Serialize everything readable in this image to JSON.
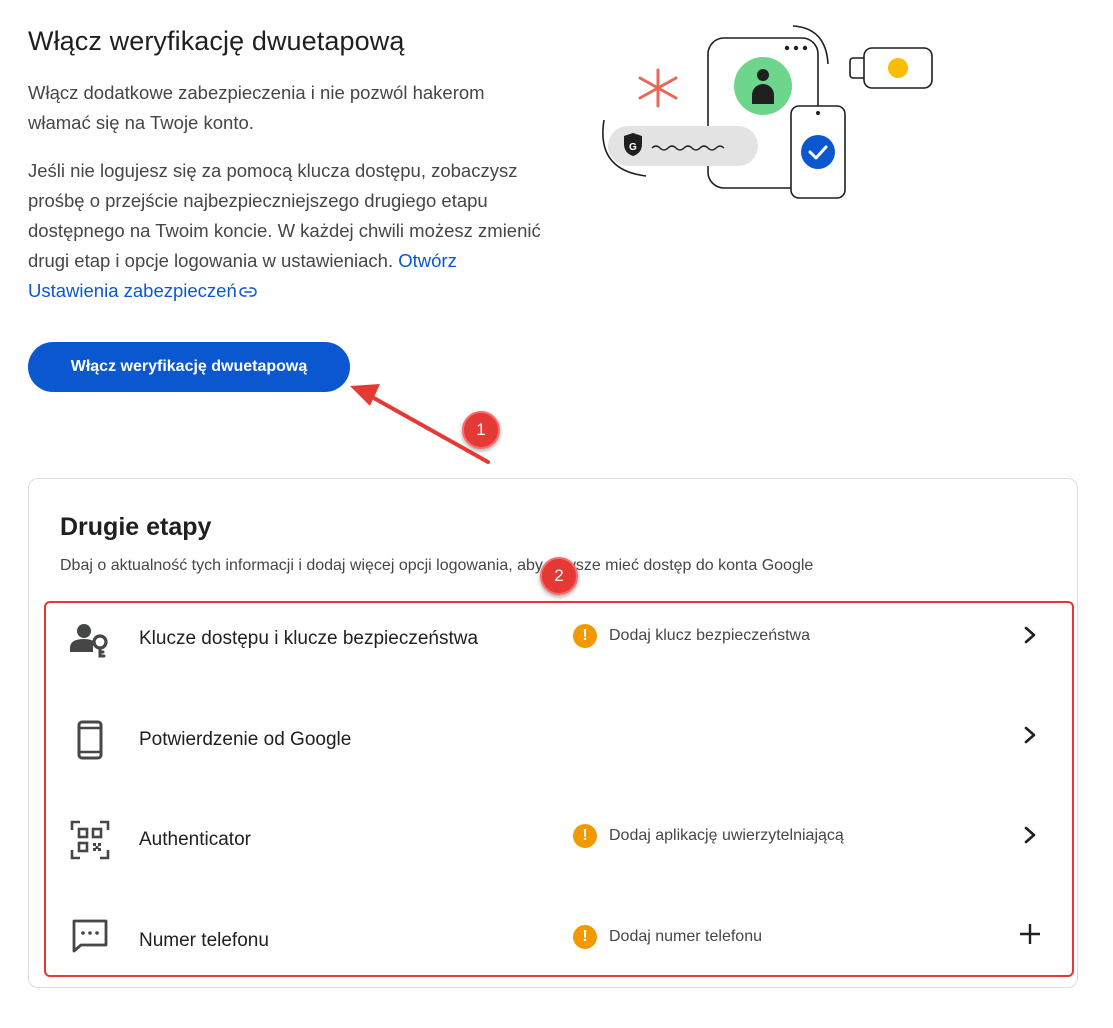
{
  "intro": {
    "title": "Włącz weryfikację dwuetapową",
    "paragraph1": "Włącz dodatkowe zabezpieczenia i nie pozwól hakerom włamać się na Twoje konto.",
    "paragraph2": "Jeśli nie logujesz się za pomocą klucza dostępu, zobaczysz prośbę o przejście najbezpieczniejszego drugiego etapu dostępnego na Twoim koncie. W każdej chwili możesz zmienić drugi etap i opcje logowania w ustawieniach.",
    "settings_link": "Otwórz Ustawienia zabezpieczeń",
    "enable_button": "Włącz weryfikację dwuetapową"
  },
  "annotations": {
    "marker1": "1",
    "marker2": "2",
    "color": "#e53935"
  },
  "second_steps": {
    "title": "Drugie etapy",
    "description": "Dbaj o aktualność tych informacji i dodaj więcej opcji logowania, aby zawsze mieć dostęp do konta Google",
    "items": [
      {
        "label": "Klucze dostępu i klucze bezpieczeństwa",
        "status": "Dodaj klucz bezpieczeństwa",
        "icon": "passkey-icon",
        "action": "chevron-right-icon"
      },
      {
        "label": "Potwierdzenie od Google",
        "status": "",
        "icon": "phone-icon",
        "action": "chevron-right-icon"
      },
      {
        "label": "Authenticator",
        "status": "Dodaj aplikację uwierzytelniającą",
        "icon": "qr-code-icon",
        "action": "chevron-right-icon"
      },
      {
        "label": "Numer telefonu",
        "status": "Dodaj numer telefonu",
        "icon": "sms-icon",
        "action": "plus-icon"
      }
    ]
  },
  "colors": {
    "primary": "#0b57d0",
    "warning": "#f29900",
    "annotation": "#e53935"
  }
}
